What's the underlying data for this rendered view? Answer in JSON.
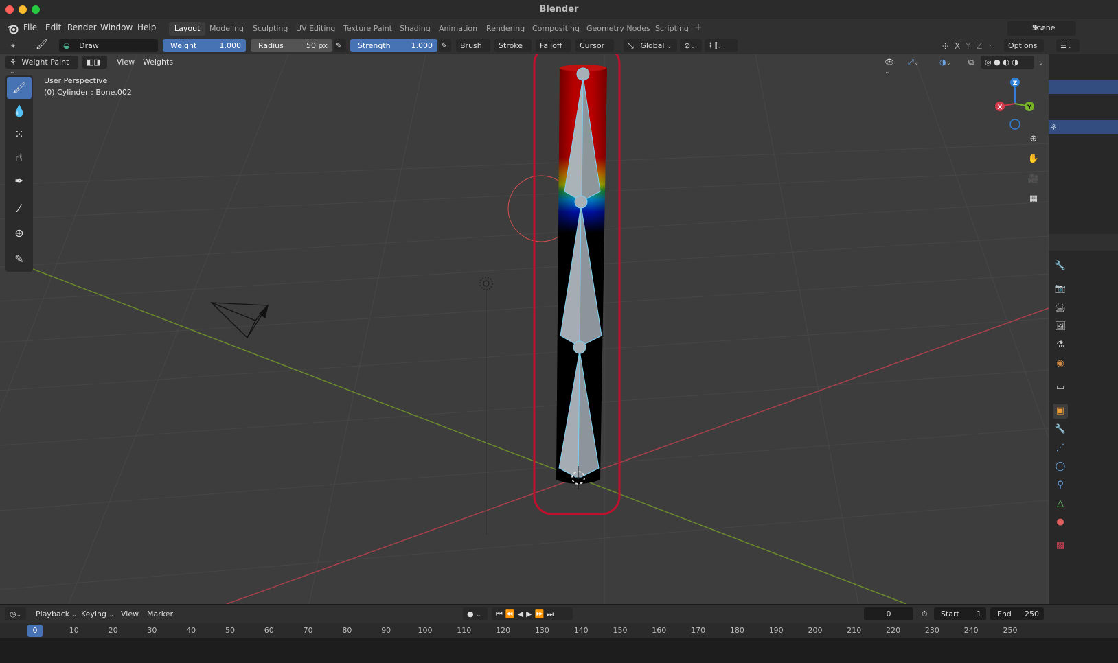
{
  "app": {
    "title": "Blender"
  },
  "menubar": {
    "items": [
      "File",
      "Edit",
      "Render",
      "Window",
      "Help"
    ],
    "workspaces": [
      "Layout",
      "Modeling",
      "Sculpting",
      "UV Editing",
      "Texture Paint",
      "Shading",
      "Animation",
      "Rendering",
      "Compositing",
      "Geometry Nodes",
      "Scripting"
    ],
    "active_workspace": "Layout",
    "add_tab": "+",
    "scene": "Scene"
  },
  "toolheader": {
    "brush_name": "Draw",
    "weight_label": "Weight",
    "weight_value": "1.000",
    "radius_label": "Radius",
    "radius_value": "50 px",
    "strength_label": "Strength",
    "strength_value": "1.000",
    "brush_menu": "Brush",
    "stroke_menu": "Stroke",
    "falloff_menu": "Falloff",
    "cursor_menu": "Cursor",
    "orientation": "Global",
    "axes": [
      "X",
      "Y",
      "Z"
    ],
    "options": "Options"
  },
  "viewport_header": {
    "mode": "Weight Paint",
    "view_menu": "View",
    "weights_menu": "Weights"
  },
  "viewport": {
    "perspective": "User Perspective",
    "object_info": "(0) Cylinder : Bone.002",
    "gizmo_axes": {
      "x": "X",
      "y": "Y",
      "z": "Z"
    },
    "colors": {
      "x_axis": "#d23a4a",
      "y_axis": "#7ab42a",
      "z_axis": "#2f7fd6",
      "highlight": "#c0102e"
    }
  },
  "tools": [
    "brush-icon",
    "blur-icon",
    "average-icon",
    "smear-icon",
    "gradient-icon",
    "sample-icon",
    "cursor-icon",
    "annotate-icon"
  ],
  "timeline": {
    "menus": [
      "Playback",
      "Keying",
      "View",
      "Marker"
    ],
    "current_frame": "0",
    "start_label": "Start",
    "start_value": "1",
    "end_label": "End",
    "end_value": "250",
    "ruler": [
      "0",
      "10",
      "20",
      "30",
      "40",
      "50",
      "60",
      "70",
      "80",
      "90",
      "100",
      "110",
      "120",
      "130",
      "140",
      "150",
      "160",
      "170",
      "180",
      "190",
      "200",
      "210",
      "220",
      "230",
      "240",
      "250"
    ]
  }
}
